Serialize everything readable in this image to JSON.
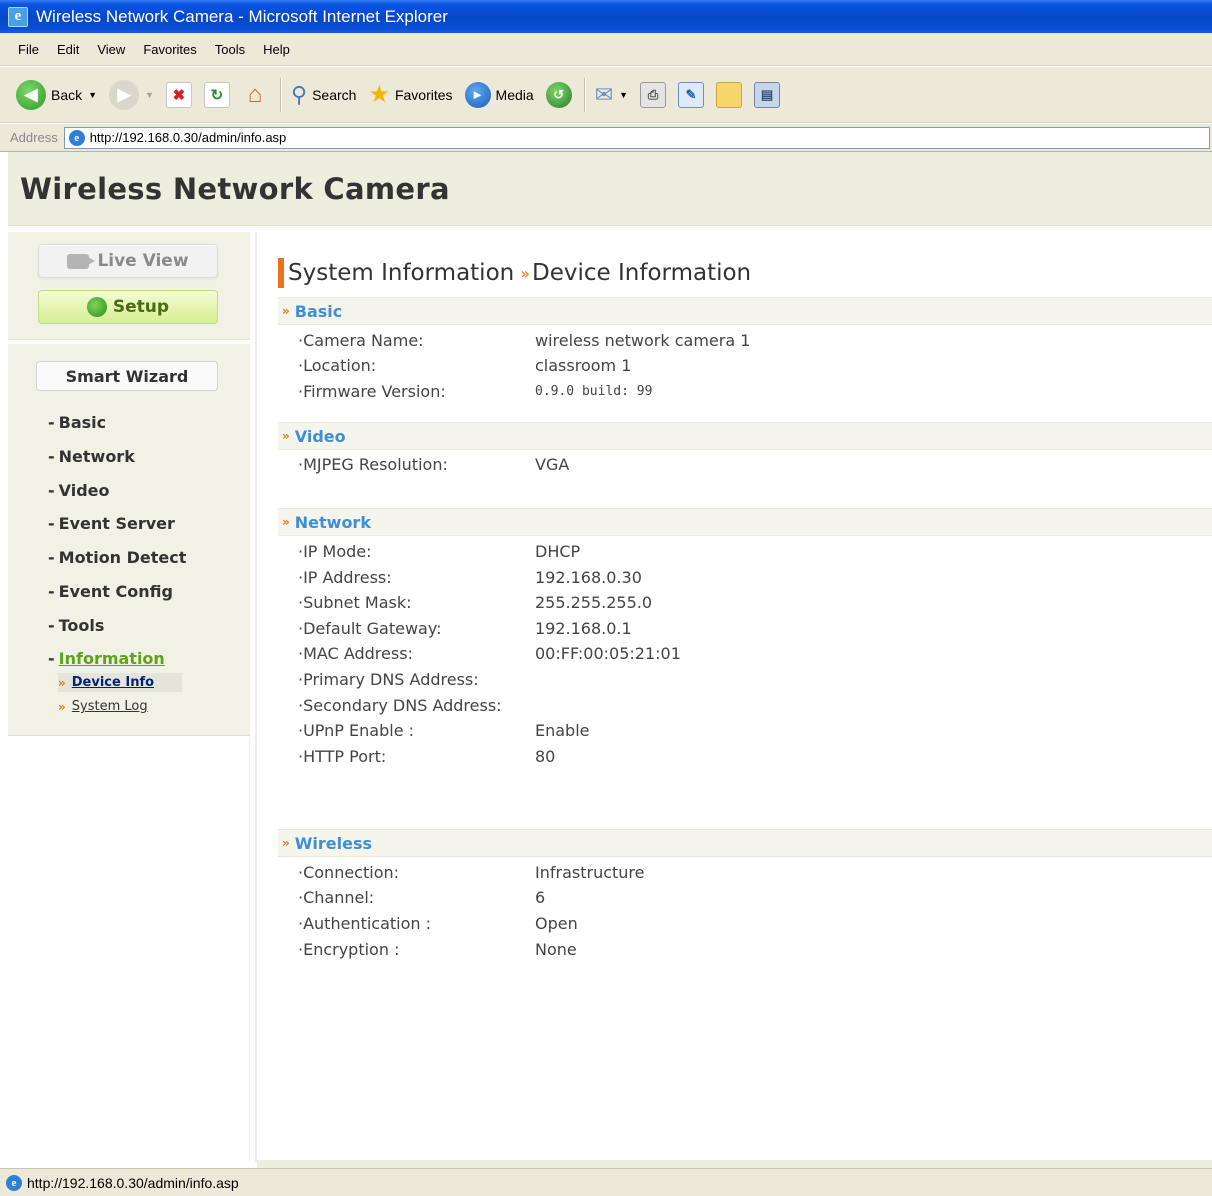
{
  "window": {
    "title": "Wireless Network Camera - Microsoft Internet Explorer"
  },
  "menu": [
    "File",
    "Edit",
    "View",
    "Favorites",
    "Tools",
    "Help"
  ],
  "toolbar": {
    "back_label": "Back",
    "search_label": "Search",
    "favorites_label": "Favorites",
    "media_label": "Media"
  },
  "address": {
    "label": "Address",
    "url": "http://192.168.0.30/admin/info.asp"
  },
  "page": {
    "title": "Wireless Network Camera"
  },
  "sidebar": {
    "live_view": "Live View",
    "setup": "Setup",
    "smart_wizard": "Smart Wizard",
    "items": [
      "Basic",
      "Network",
      "Video",
      "Event Server",
      "Motion Detect",
      "Event Config",
      "Tools",
      "Information"
    ],
    "active_item": "Information",
    "subitems": [
      {
        "label": "Device Info",
        "active": true
      },
      {
        "label": "System Log",
        "active": false
      }
    ]
  },
  "main": {
    "heading_left": "System Information",
    "heading_right": "Device Information",
    "sections": [
      {
        "title": "Basic",
        "rows": [
          {
            "label": "Camera Name:",
            "value": "wireless network camera 1"
          },
          {
            "label": "Location:",
            "value": "classroom 1"
          },
          {
            "label": "Firmware Version:",
            "value": "0.9.0 build: 99"
          }
        ]
      },
      {
        "title": "Video",
        "rows": [
          {
            "label": "MJPEG Resolution:",
            "value": "VGA"
          }
        ]
      },
      {
        "title": "Network",
        "rows": [
          {
            "label": "IP Mode:",
            "value": "DHCP"
          },
          {
            "label": "IP Address:",
            "value": "192.168.0.30"
          },
          {
            "label": "Subnet Mask:",
            "value": "255.255.255.0"
          },
          {
            "label": "Default Gateway:",
            "value": "192.168.0.1"
          },
          {
            "label": "MAC Address:",
            "value": "00:FF:00:05:21:01"
          },
          {
            "label": "Primary DNS Address:",
            "value": ""
          },
          {
            "label": "Secondary DNS Address:",
            "value": ""
          },
          {
            "label": "UPnP Enable :",
            "value": "Enable"
          },
          {
            "label": "HTTP Port:",
            "value": "80"
          }
        ]
      },
      {
        "title": "Wireless",
        "rows": [
          {
            "label": "Connection:",
            "value": "Infrastructure"
          },
          {
            "label": "Channel:",
            "value": "6"
          },
          {
            "label": "Authentication :",
            "value": "Open"
          },
          {
            "label": "Encryption :",
            "value": "None"
          }
        ]
      }
    ]
  },
  "status": {
    "url": "http://192.168.0.30/admin/info.asp"
  },
  "colors": {
    "accent_orange": "#e8731a",
    "section_blue": "#3e8fd6",
    "active_green": "#5ea31b",
    "active_sub_navy": "#00237a"
  }
}
